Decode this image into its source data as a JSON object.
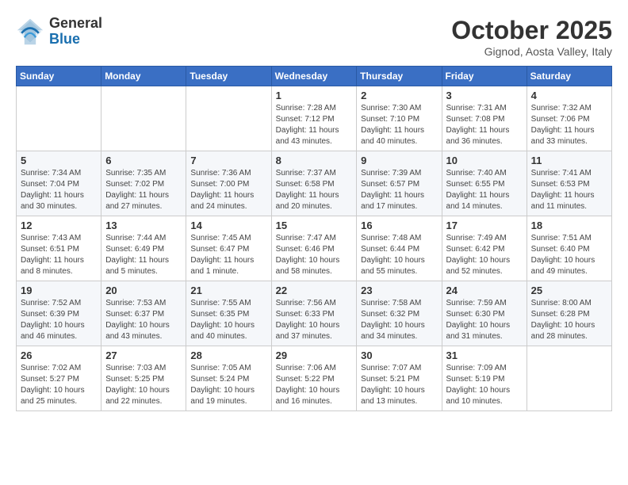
{
  "header": {
    "logo": {
      "general": "General",
      "blue": "Blue"
    },
    "title": "October 2025",
    "location": "Gignod, Aosta Valley, Italy"
  },
  "weekdays": [
    "Sunday",
    "Monday",
    "Tuesday",
    "Wednesday",
    "Thursday",
    "Friday",
    "Saturday"
  ],
  "weeks": [
    [
      {
        "day": "",
        "info": ""
      },
      {
        "day": "",
        "info": ""
      },
      {
        "day": "",
        "info": ""
      },
      {
        "day": "1",
        "info": "Sunrise: 7:28 AM\nSunset: 7:12 PM\nDaylight: 11 hours and 43 minutes."
      },
      {
        "day": "2",
        "info": "Sunrise: 7:30 AM\nSunset: 7:10 PM\nDaylight: 11 hours and 40 minutes."
      },
      {
        "day": "3",
        "info": "Sunrise: 7:31 AM\nSunset: 7:08 PM\nDaylight: 11 hours and 36 minutes."
      },
      {
        "day": "4",
        "info": "Sunrise: 7:32 AM\nSunset: 7:06 PM\nDaylight: 11 hours and 33 minutes."
      }
    ],
    [
      {
        "day": "5",
        "info": "Sunrise: 7:34 AM\nSunset: 7:04 PM\nDaylight: 11 hours and 30 minutes."
      },
      {
        "day": "6",
        "info": "Sunrise: 7:35 AM\nSunset: 7:02 PM\nDaylight: 11 hours and 27 minutes."
      },
      {
        "day": "7",
        "info": "Sunrise: 7:36 AM\nSunset: 7:00 PM\nDaylight: 11 hours and 24 minutes."
      },
      {
        "day": "8",
        "info": "Sunrise: 7:37 AM\nSunset: 6:58 PM\nDaylight: 11 hours and 20 minutes."
      },
      {
        "day": "9",
        "info": "Sunrise: 7:39 AM\nSunset: 6:57 PM\nDaylight: 11 hours and 17 minutes."
      },
      {
        "day": "10",
        "info": "Sunrise: 7:40 AM\nSunset: 6:55 PM\nDaylight: 11 hours and 14 minutes."
      },
      {
        "day": "11",
        "info": "Sunrise: 7:41 AM\nSunset: 6:53 PM\nDaylight: 11 hours and 11 minutes."
      }
    ],
    [
      {
        "day": "12",
        "info": "Sunrise: 7:43 AM\nSunset: 6:51 PM\nDaylight: 11 hours and 8 minutes."
      },
      {
        "day": "13",
        "info": "Sunrise: 7:44 AM\nSunset: 6:49 PM\nDaylight: 11 hours and 5 minutes."
      },
      {
        "day": "14",
        "info": "Sunrise: 7:45 AM\nSunset: 6:47 PM\nDaylight: 11 hours and 1 minute."
      },
      {
        "day": "15",
        "info": "Sunrise: 7:47 AM\nSunset: 6:46 PM\nDaylight: 10 hours and 58 minutes."
      },
      {
        "day": "16",
        "info": "Sunrise: 7:48 AM\nSunset: 6:44 PM\nDaylight: 10 hours and 55 minutes."
      },
      {
        "day": "17",
        "info": "Sunrise: 7:49 AM\nSunset: 6:42 PM\nDaylight: 10 hours and 52 minutes."
      },
      {
        "day": "18",
        "info": "Sunrise: 7:51 AM\nSunset: 6:40 PM\nDaylight: 10 hours and 49 minutes."
      }
    ],
    [
      {
        "day": "19",
        "info": "Sunrise: 7:52 AM\nSunset: 6:39 PM\nDaylight: 10 hours and 46 minutes."
      },
      {
        "day": "20",
        "info": "Sunrise: 7:53 AM\nSunset: 6:37 PM\nDaylight: 10 hours and 43 minutes."
      },
      {
        "day": "21",
        "info": "Sunrise: 7:55 AM\nSunset: 6:35 PM\nDaylight: 10 hours and 40 minutes."
      },
      {
        "day": "22",
        "info": "Sunrise: 7:56 AM\nSunset: 6:33 PM\nDaylight: 10 hours and 37 minutes."
      },
      {
        "day": "23",
        "info": "Sunrise: 7:58 AM\nSunset: 6:32 PM\nDaylight: 10 hours and 34 minutes."
      },
      {
        "day": "24",
        "info": "Sunrise: 7:59 AM\nSunset: 6:30 PM\nDaylight: 10 hours and 31 minutes."
      },
      {
        "day": "25",
        "info": "Sunrise: 8:00 AM\nSunset: 6:28 PM\nDaylight: 10 hours and 28 minutes."
      }
    ],
    [
      {
        "day": "26",
        "info": "Sunrise: 7:02 AM\nSunset: 5:27 PM\nDaylight: 10 hours and 25 minutes."
      },
      {
        "day": "27",
        "info": "Sunrise: 7:03 AM\nSunset: 5:25 PM\nDaylight: 10 hours and 22 minutes."
      },
      {
        "day": "28",
        "info": "Sunrise: 7:05 AM\nSunset: 5:24 PM\nDaylight: 10 hours and 19 minutes."
      },
      {
        "day": "29",
        "info": "Sunrise: 7:06 AM\nSunset: 5:22 PM\nDaylight: 10 hours and 16 minutes."
      },
      {
        "day": "30",
        "info": "Sunrise: 7:07 AM\nSunset: 5:21 PM\nDaylight: 10 hours and 13 minutes."
      },
      {
        "day": "31",
        "info": "Sunrise: 7:09 AM\nSunset: 5:19 PM\nDaylight: 10 hours and 10 minutes."
      },
      {
        "day": "",
        "info": ""
      }
    ]
  ]
}
